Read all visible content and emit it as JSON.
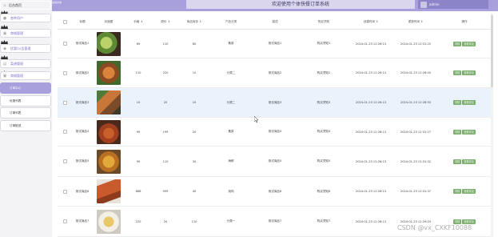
{
  "header": {
    "brand": "某某系统",
    "title": "欢迎使用个体快餐订单系统",
    "user": "admin"
  },
  "sidebar": {
    "home": "后台首页",
    "items": [
      {
        "label": "各种用户"
      },
      {
        "label": "商城管理"
      },
      {
        "label": "优惠/公告管理"
      },
      {
        "label": "菜谱管理"
      },
      {
        "label": "商城管理"
      }
    ],
    "sub_items": [
      {
        "label": "订单中心",
        "active": true
      },
      {
        "label": "优惠列表",
        "active": false
      },
      {
        "label": "订单列表",
        "active": false
      },
      {
        "label": "订单配送",
        "active": false
      }
    ]
  },
  "table": {
    "headers": [
      "",
      "标题",
      "封面图",
      "价格 ↕",
      "原价 ↕",
      "商品库存 ↕",
      "产品分类",
      "描述",
      "购买须知",
      "创建时间 ↕",
      "更新时间 ↕",
      "操作"
    ],
    "buttons": {
      "detail": "详情",
      "review": "查看评论"
    },
    "rows": [
      {
        "title": "测试商品1",
        "price": "69",
        "orig": "110",
        "stock": "80",
        "category": "素菜",
        "desc": "测试商品1",
        "notice": "购买须知1",
        "created": "2024-01-23 12:26:13",
        "updated": "2024-01-23 12:31:22",
        "img": "salad"
      },
      {
        "title": "测试商品2",
        "price": "110",
        "orig": "220",
        "stock": "10",
        "category": "分类二",
        "desc": "测试商品2",
        "notice": "购买须知2",
        "created": "2024-01-23 12:26:13",
        "updated": "2024-01-23 12:28:45",
        "img": "grill"
      },
      {
        "title": "测试商品3",
        "price": "10",
        "orig": "20",
        "stock": "10",
        "category": "分类二",
        "desc": "测试商品3",
        "notice": "购买须知3",
        "created": "2024-01-23 12:26:13",
        "updated": "2024-01-23 12:28:55",
        "img": "skewer"
      },
      {
        "title": "测试商品4",
        "price": "99",
        "orig": "199",
        "stock": "20",
        "category": "素菜",
        "desc": "测试商品4",
        "notice": "购买须知4",
        "created": "2024-01-23 12:26:13",
        "updated": "2024-01-23 12:31:27",
        "img": "bbq"
      },
      {
        "title": "测试商品5",
        "price": "99",
        "orig": "110",
        "stock": "30",
        "category": "海鲜",
        "desc": "测试商品5",
        "notice": "购买须知5",
        "created": "2024-01-23 12:26:13",
        "updated": "2024-01-23 12:31:32",
        "img": "fried"
      },
      {
        "title": "测试商品6",
        "price": "888",
        "orig": "999",
        "stock": "40",
        "category": "烧肉",
        "desc": "测试商品6",
        "notice": "购买须知6",
        "created": "2024-01-23 12:26:13",
        "updated": "2024-01-23 12:31:37",
        "img": "lobster"
      },
      {
        "title": "测试商品7",
        "price": "220",
        "orig": "20",
        "stock": "110",
        "category": "分类一",
        "desc": "测试商品7",
        "notice": "购买须知7",
        "created": "2024-01-23 12:26:13",
        "updated": "2024-01-23 12:29:03",
        "img": "plate"
      }
    ]
  },
  "watermark": "CSDN @vx_CXKF10088",
  "colors": {
    "accent": "#a8a0dc",
    "action_button": "#7cae6e",
    "highlight_row": "#eaf2fb"
  }
}
